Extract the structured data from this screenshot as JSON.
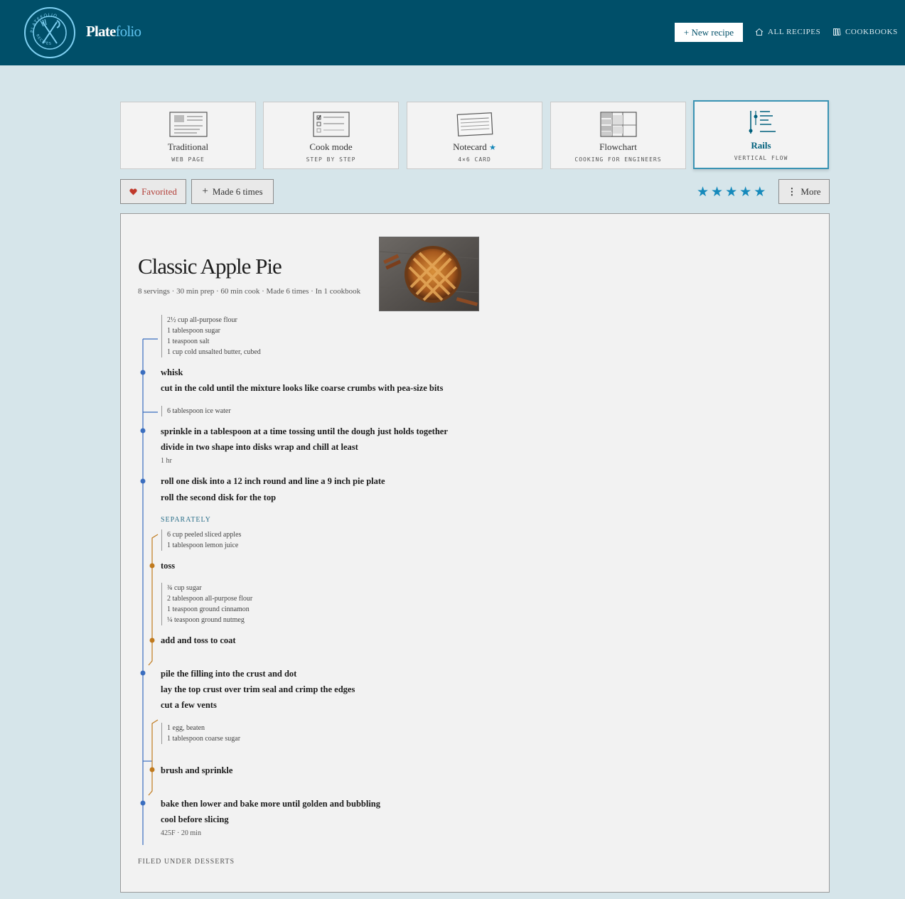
{
  "header": {
    "brand_part1": "Plate",
    "brand_part2": "folio",
    "badge_top_text": "PLATEFOLIO",
    "badge_bottom_text": "RECIPES",
    "new_recipe_label": "+ New recipe",
    "nav": [
      {
        "label": "ALL RECIPES",
        "icon": "home-icon"
      },
      {
        "label": "COOKBOOKS",
        "icon": "books-icon"
      }
    ]
  },
  "views": [
    {
      "title": "Traditional",
      "subtitle": "WEB PAGE",
      "icon": "traditional-view-icon"
    },
    {
      "title": "Cook mode",
      "subtitle": "STEP BY STEP",
      "icon": "cook-mode-icon"
    },
    {
      "title": "Notecard",
      "subtitle": "4×6 CARD",
      "icon": "notecard-icon",
      "starred": true
    },
    {
      "title": "Flowchart",
      "subtitle": "COOKING FOR ENGINEERS",
      "icon": "flowchart-icon"
    },
    {
      "title": "Rails",
      "subtitle": "VERTICAL FLOW",
      "icon": "rails-icon",
      "active": true
    }
  ],
  "actions": {
    "favorited_label": "Favorited",
    "made_label": "Made 6 times",
    "more_label": "More",
    "rating": 5,
    "rating_max": 5
  },
  "colors": {
    "header": "#004f69",
    "accent": "#1589bb",
    "rail_main": "#3a6ebf",
    "rail_branch": "#c07a1e",
    "heart": "#c0392b"
  },
  "recipe": {
    "title": "Classic Apple Pie",
    "meta": "8 servings · 30 min prep · 60 min cook · Made 6 times · In 1 cookbook",
    "photo_alt": "apple pie with lattice crust",
    "groups": [
      {
        "ingredients": [
          "2½ cup all-purpose flour",
          "1 tablespoon sugar",
          "1 teaspoon salt",
          "1 cup cold unsalted butter, cubed"
        ]
      },
      {
        "ingredients": [
          "6 tablespoon ice water"
        ]
      },
      {
        "ingredients": [
          "6 cup peeled sliced apples",
          "1 tablespoon lemon juice"
        ]
      },
      {
        "ingredients": [
          "¾ cup sugar",
          "2 tablespoon all-purpose flour",
          "1 teaspoon ground cinnamon",
          "¼ teaspoon ground nutmeg"
        ]
      },
      {
        "ingredients": [
          "1 egg, beaten",
          "1 tablespoon coarse sugar"
        ]
      }
    ],
    "steps": [
      "whisk",
      "cut in the cold until the mixture looks like coarse crumbs with pea-size bits",
      "sprinkle in a tablespoon at a time tossing until the dough just holds together",
      "divide in two shape into disks wrap and chill at least",
      "roll one disk into a 12 inch round and line a 9 inch pie plate",
      "roll the second disk for the top",
      "toss",
      "add and toss to coat",
      "pile the filling into the crust and dot",
      "lay the top crust over trim seal and crimp the edges",
      "cut a few vents",
      "brush and sprinkle",
      "bake then lower and bake more until golden and bubbling",
      "cool before slicing"
    ],
    "notes": [
      "1 hr",
      "425F · 20 min"
    ],
    "separately_label": "SEPARATELY",
    "filed_under": "FILED UNDER DESSERTS"
  }
}
